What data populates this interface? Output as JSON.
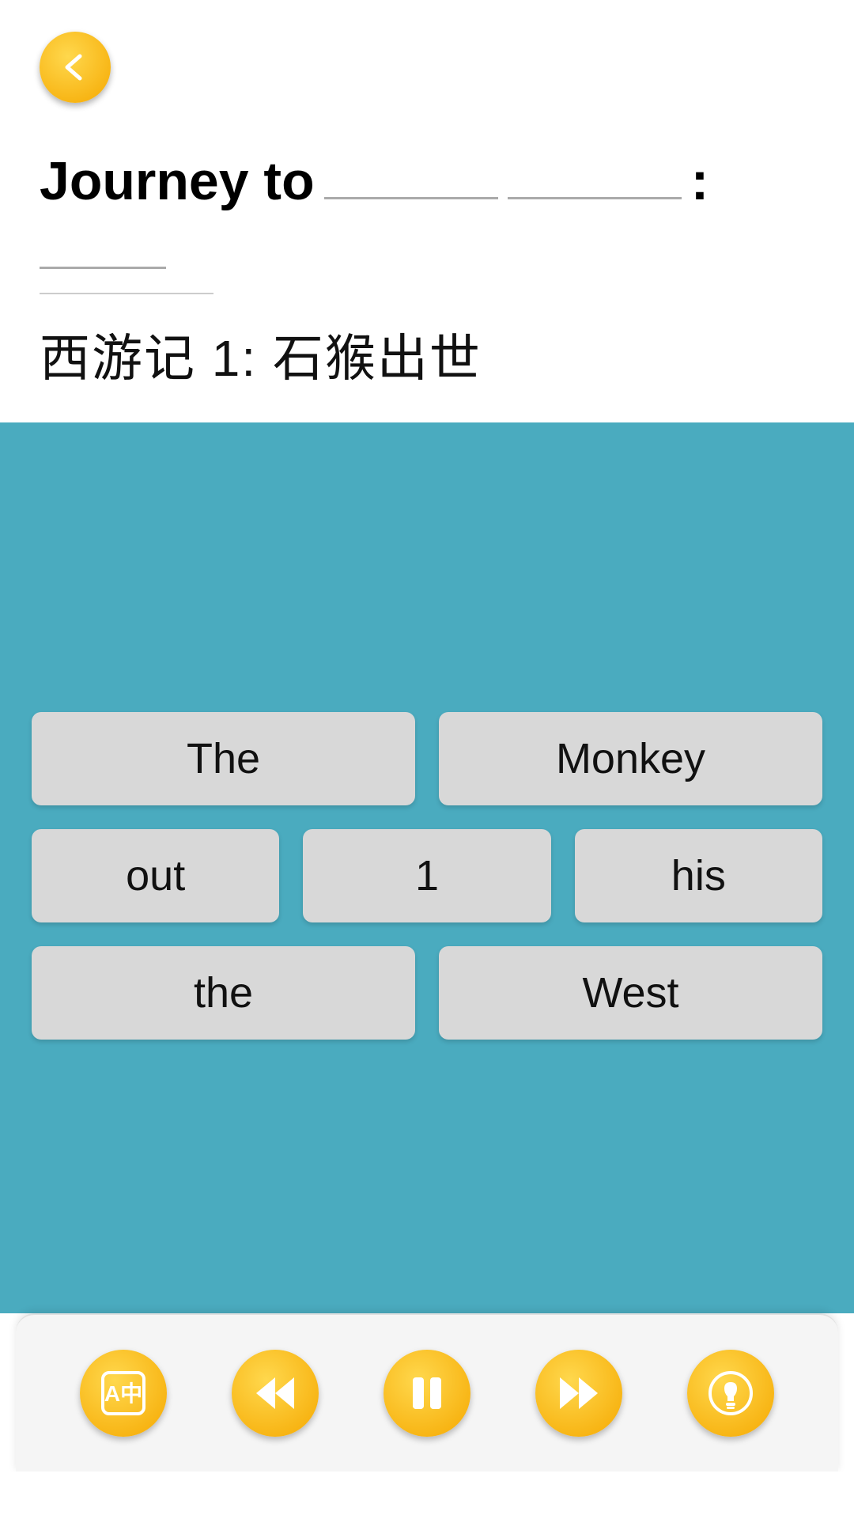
{
  "header": {
    "back_label": "back"
  },
  "title": {
    "prefix": "Journey to",
    "blank1": "",
    "blank2": "",
    "colon": ":",
    "blank3": ""
  },
  "subtitle": "西游记 1: 石猴出世",
  "words": {
    "row1": [
      "The",
      "Monkey"
    ],
    "row2": [
      "out",
      "1",
      "his"
    ],
    "row3": [
      "the",
      "West"
    ]
  },
  "toolbar": {
    "translate_label": "translate",
    "rewind_label": "rewind",
    "pause_label": "pause",
    "fastforward_label": "fast-forward",
    "hint_label": "hint"
  }
}
